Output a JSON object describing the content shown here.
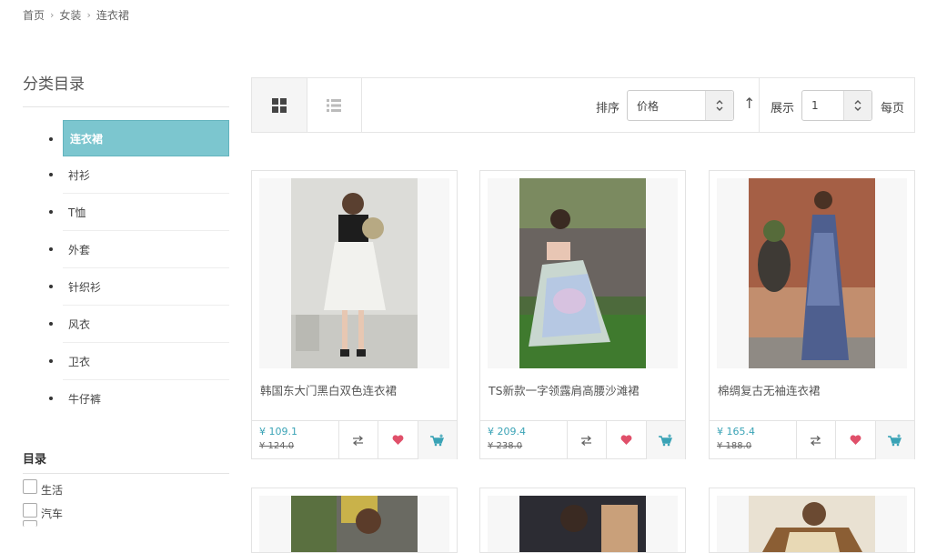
{
  "breadcrumb": {
    "items": [
      "首页",
      "女装",
      "连衣裙"
    ]
  },
  "sidebar": {
    "title": "分类目录",
    "categories": [
      {
        "label": "连衣裙",
        "active": true
      },
      {
        "label": "衬衫"
      },
      {
        "label": "T恤"
      },
      {
        "label": "外套"
      },
      {
        "label": "针织衫"
      },
      {
        "label": "风衣"
      },
      {
        "label": "卫衣"
      },
      {
        "label": "牛仔裤"
      }
    ],
    "section2_title": "目录",
    "checkboxes": [
      "生活",
      "汽车"
    ]
  },
  "toolbar": {
    "sort_label": "排序",
    "sort_value": "价格",
    "show_label": "展示",
    "show_value": "1",
    "per_page_label": "每页"
  },
  "products": [
    {
      "name": "韩国东大门黑白双色连衣裙",
      "price": "¥ 109.1",
      "old_price": "¥ 124.0"
    },
    {
      "name": "TS新款一字领露肩高腰沙滩裙",
      "price": "¥ 209.4",
      "old_price": "¥ 238.0"
    },
    {
      "name": "棉绸复古无袖连衣裙",
      "price": "¥ 165.4",
      "old_price": "¥ 188.0"
    }
  ],
  "colors": {
    "accent": "#7cc6cf",
    "price": "#3aa3b6",
    "heart": "#e0506a"
  },
  "icons": [
    "grid-view-icon",
    "list-view-icon",
    "sort-spinner-icon",
    "sort-arrow-icon",
    "compare-icon",
    "heart-icon",
    "cart-icon"
  ]
}
